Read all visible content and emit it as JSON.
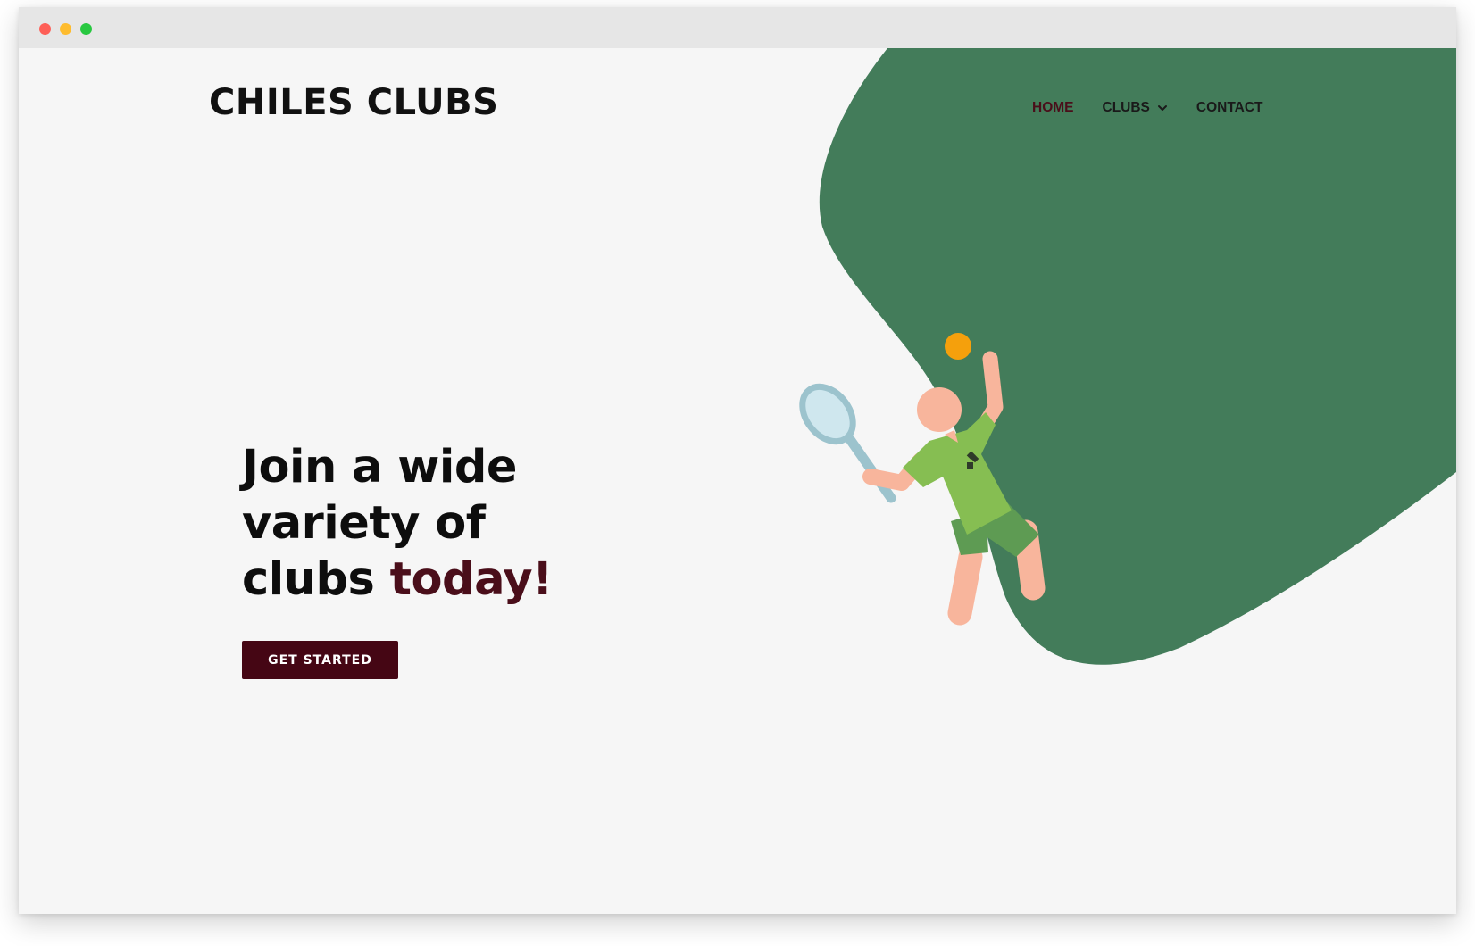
{
  "window": {
    "controls": [
      "close",
      "minimize",
      "maximize"
    ]
  },
  "header": {
    "logo": "CHILES CLUBS",
    "nav": {
      "home": "HOME",
      "clubs": "CLUBS",
      "contact": "CONTACT"
    }
  },
  "hero": {
    "line1": "Join a wide",
    "line2": "variety of",
    "line3_plain": "clubs ",
    "line3_accent": "today!",
    "cta_label": "GET STARTED"
  },
  "colors": {
    "accent": "#4a0e1a",
    "button_bg": "#450614",
    "blob": "#437c5a",
    "background": "#f6f6f6",
    "ball": "#f5a00c",
    "shirt": "#86be52",
    "shorts": "#5e9b53",
    "skin": "#f8b59c",
    "racket": "#9cc3cd"
  },
  "icons": [
    "chevron-down-icon",
    "tennis-player-illustration",
    "tennis-ball-icon",
    "tennis-racket-icon"
  ]
}
